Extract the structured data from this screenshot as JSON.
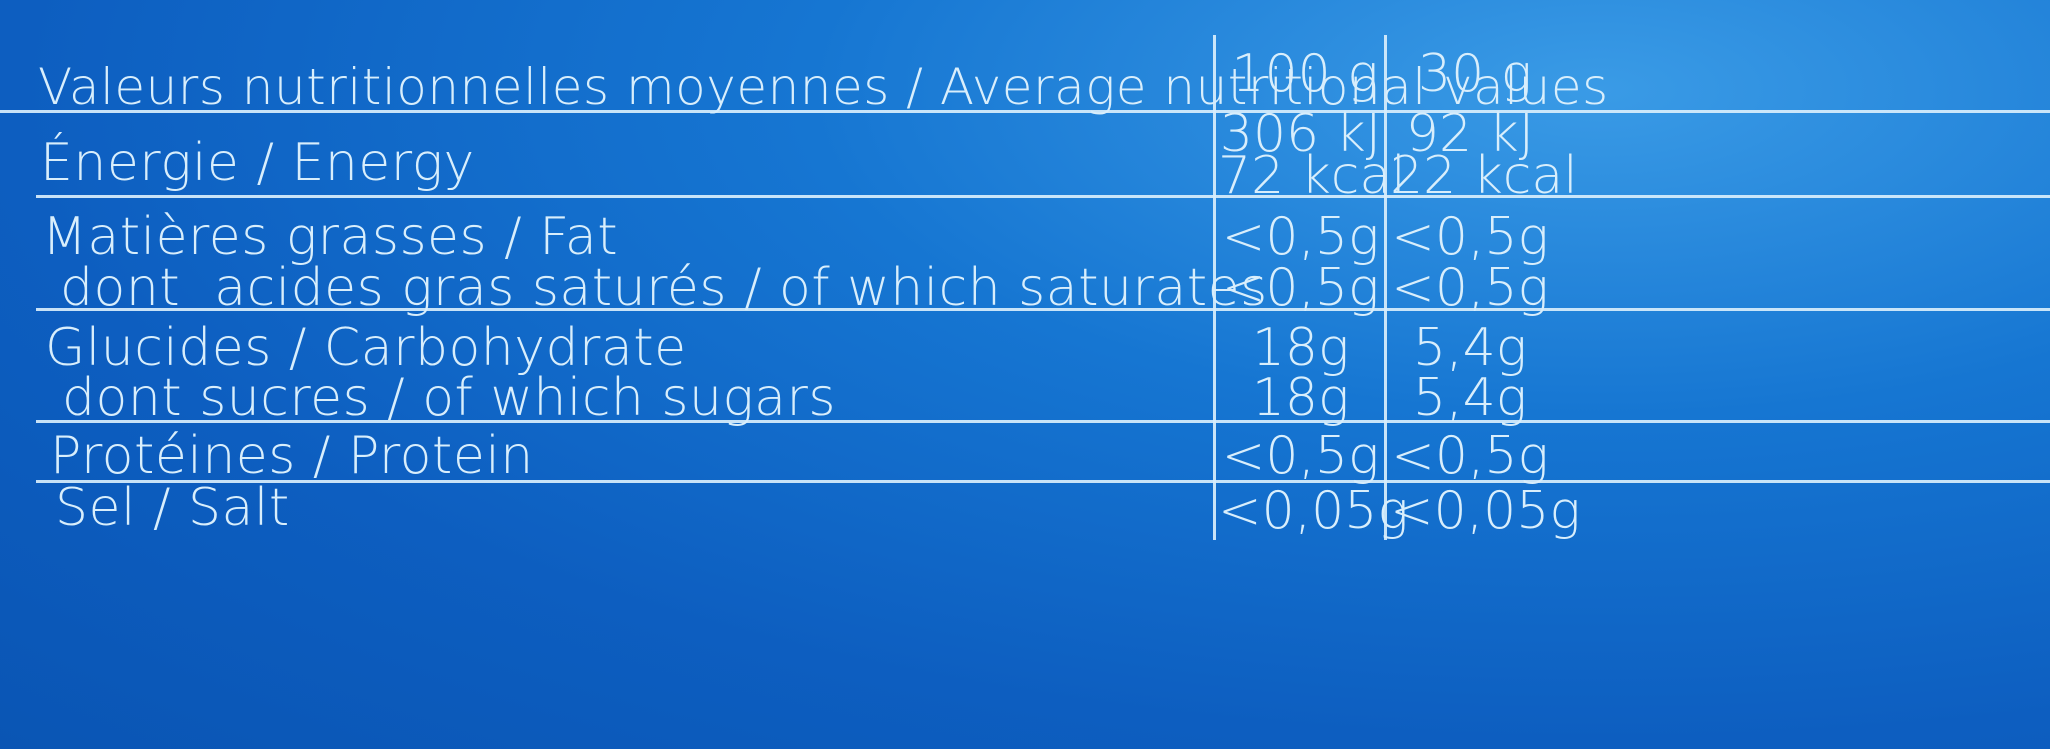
{
  "header": {
    "title": "Valeurs nutritionnelles moyennes / Average nutritional values",
    "col_100g": "100 g",
    "col_30g": "30 g"
  },
  "rows": [
    {
      "label": "Énergie / Energy",
      "v100_kj": "306 kJ",
      "v100_kcal": "72 kcal",
      "v30_kj": "92 kJ",
      "v30_kcal": "22 kcal"
    },
    {
      "label": "Matières grasses / Fat",
      "v100": "<0,5g",
      "v30": "<0,5g"
    },
    {
      "label": "dont  acides gras saturés / of which saturates",
      "v100": "<0,5g",
      "v30": "<0,5g"
    },
    {
      "label": "Glucides / Carbohydrate",
      "v100": "18g",
      "v30": "5,4g"
    },
    {
      "label": "dont sucres / of which sugars",
      "v100": "18g",
      "v30": "5,4g"
    },
    {
      "label": "Protéines / Protein",
      "v100": "<0,5g",
      "v30": "<0,5g"
    },
    {
      "label": "Sel / Salt",
      "v100": "<0,05g",
      "v30": "<0,05g"
    }
  ]
}
